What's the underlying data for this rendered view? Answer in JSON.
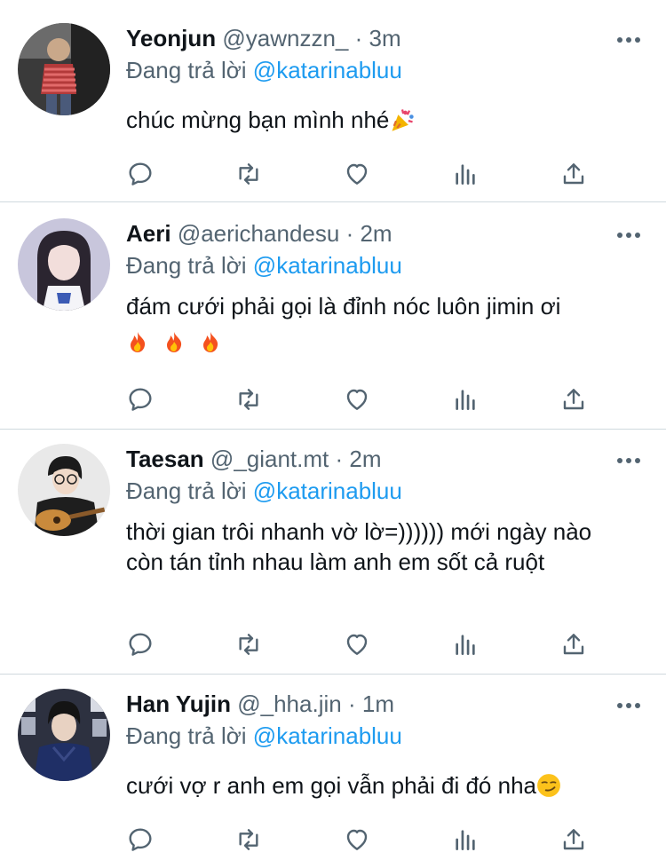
{
  "replying_to_label": "Đang trả lời",
  "tweets": [
    {
      "display_name": "Yeonjun",
      "handle": "@yawnzzn_",
      "separator": "·",
      "time": "3m",
      "mention": "@katarinabluu",
      "text": "chúc mừng bạn mình nhé",
      "emoji": "party-popper-emoji",
      "avatar_icon": "avatar-yeonjun"
    },
    {
      "display_name": "Aeri",
      "handle": "@aerichandesu",
      "separator": "·",
      "time": "2m",
      "mention": "@katarinabluu",
      "text": "đám cưới phải gọi là đỉnh nóc luôn jimin ơi",
      "emoji": "fire-emoji",
      "avatar_icon": "avatar-aeri"
    },
    {
      "display_name": "Taesan",
      "handle": "@_giant.mt",
      "separator": "·",
      "time": "2m",
      "mention": "@katarinabluu",
      "text": "thời gian trôi nhanh vờ lờ=)))))) mới ngày nào còn tán tỉnh nhau làm anh em sốt cả ruột",
      "avatar_icon": "avatar-taesan"
    },
    {
      "display_name": "Han Yujin",
      "handle": "@_hha.jin",
      "separator": "·",
      "time": "1m",
      "mention": "@katarinabluu",
      "text": "cưới vợ r anh em gọi vẫn phải đi đó nha",
      "emoji": "smirk-emoji",
      "avatar_icon": "avatar-hanyujin"
    }
  ],
  "colors": {
    "text": "#0f1419",
    "secondary": "#536471",
    "link": "#1d9bf0",
    "divider": "#cfd9de"
  }
}
